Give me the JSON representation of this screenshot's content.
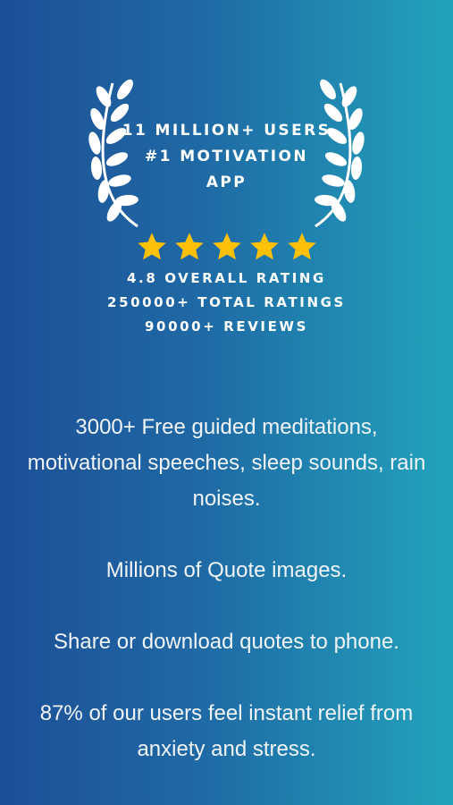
{
  "award": {
    "line1": "11 MILLION+ USERS",
    "line2": "#1 MOTIVATION",
    "line3": "APP"
  },
  "rating": {
    "stars": 5,
    "star_color": "#ffc107",
    "overall": "4.8 OVERALL RATING",
    "total": "250000+ TOTAL RATINGS",
    "reviews": "90000+ REVIEWS"
  },
  "features": [
    "3000+ Free guided meditations, motivational speeches, sleep sounds, rain noises.",
    "Millions of Quote images.",
    "Share or download quotes to phone.",
    "87% of our users feel instant relief from anxiety and stress."
  ],
  "colors": {
    "gradient_left": "#1d4f96",
    "gradient_right": "#22a3bc",
    "text": "#ffffff"
  }
}
